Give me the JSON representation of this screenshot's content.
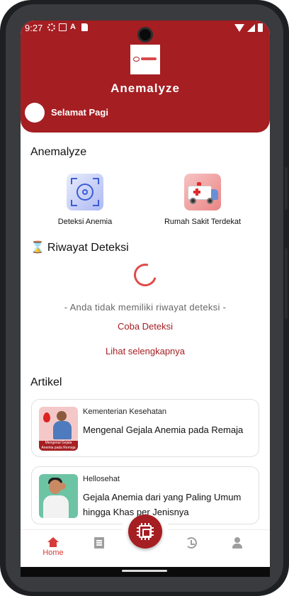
{
  "status_bar": {
    "time": "9:27",
    "left_icons": [
      "gear-icon",
      "gmail-icon",
      "a-icon",
      "sd-card-icon"
    ],
    "right_icons": [
      "wifi-icon",
      "signal-icon",
      "battery-icon"
    ]
  },
  "header": {
    "app_title": "Anemalyze",
    "greeting": "Selamat Pagi",
    "bg_color": "#a51e22"
  },
  "features": {
    "section_title": "Anemalyze",
    "items": [
      {
        "label": "Deteksi Anemia",
        "icon": "target-scan-icon"
      },
      {
        "label": "Rumah Sakit Terdekat",
        "icon": "ambulance-icon"
      }
    ]
  },
  "history": {
    "section_title": "Riwayat Deteksi",
    "icon": "⌛",
    "empty_text": "- Anda tidak memiliki riwayat deteksi -",
    "try_link": "Coba Deteksi",
    "see_more_link": "Lihat selengkapnya"
  },
  "articles": {
    "section_title": "Artikel",
    "items": [
      {
        "source": "Kementerian Kesehatan",
        "title": "Mengenal Gejala Anemia pada Remaja",
        "thumb_caption": "Mengenal Gejala Anemia pada Remaja"
      },
      {
        "source": "Hellosehat",
        "title": "Gejala Anemia dari yang Paling Umum hingga Khas per Jenisnya"
      }
    ]
  },
  "bottom_nav": {
    "items": [
      {
        "label": "Home",
        "icon": "home-icon",
        "active": true
      },
      {
        "label": "",
        "icon": "article-icon",
        "active": false
      },
      {
        "label": "",
        "icon": "history-icon",
        "active": false
      },
      {
        "label": "",
        "icon": "profile-icon",
        "active": false
      }
    ],
    "fab_icon": "chip-scan-icon",
    "accent_color": "#d83a3a"
  }
}
